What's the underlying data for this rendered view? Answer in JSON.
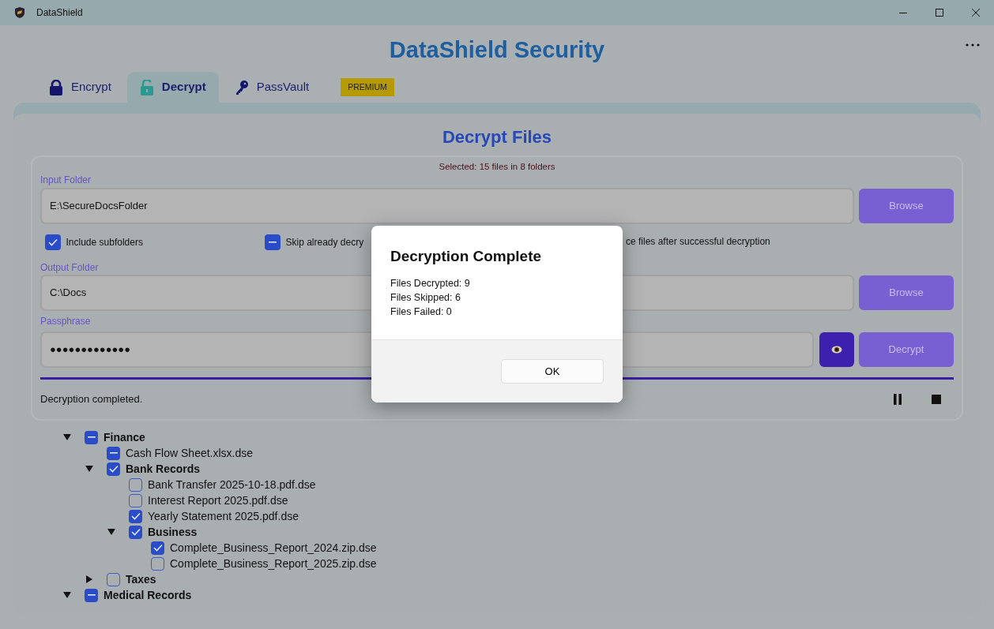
{
  "window": {
    "title": "DataShield"
  },
  "app_title": "DataShield Security",
  "tabs": [
    {
      "label": "Encrypt",
      "selected": false
    },
    {
      "label": "Decrypt",
      "selected": true
    },
    {
      "label": "PassVault",
      "selected": false
    }
  ],
  "premium_badge": "PREMIUM",
  "panel_title": "Decrypt Files",
  "selection_summary": "Selected: 15 files in 8 folders",
  "input_folder": {
    "label": "Input Folder",
    "value": "E:\\SecureDocsFolder",
    "button": "Browse"
  },
  "options": [
    {
      "label": "Include subfolders",
      "checked": true,
      "indeterminate": false
    },
    {
      "label": "Skip already decry",
      "checked": true,
      "indeterminate": true
    },
    {
      "label": "ce files after successful decryption"
    }
  ],
  "output_folder": {
    "label": "Output Folder",
    "value": "C:\\Docs",
    "button": "Browse"
  },
  "passphrase": {
    "label": "Passphrase",
    "value": "●●●●●●●●●●●●●",
    "button": "Decrypt"
  },
  "progress": {
    "level": 1
  },
  "status": "Decryption completed.",
  "tree": [
    {
      "name": "Finance",
      "kind": "folder",
      "expanded": true,
      "checked": true,
      "indeterminate": true,
      "children": [
        {
          "name": "Cash Flow Sheet.xlsx.dse",
          "kind": "file",
          "checked": true,
          "indeterminate": true
        },
        {
          "name": "Bank Records",
          "kind": "folder",
          "expanded": true,
          "checked": true,
          "indeterminate": false,
          "children": [
            {
              "name": "Bank Transfer 2025-10-18.pdf.dse",
              "kind": "file",
              "checked": false
            },
            {
              "name": "Interest Report 2025.pdf.dse",
              "kind": "file",
              "checked": false
            },
            {
              "name": "Yearly Statement 2025.pdf.dse",
              "kind": "file",
              "checked": true,
              "indeterminate": false
            },
            {
              "name": "Business",
              "kind": "folder",
              "expanded": true,
              "checked": true,
              "indeterminate": false,
              "children": [
                {
                  "name": "Complete_Business_Report_2024.zip.dse",
                  "kind": "file",
                  "checked": true,
                  "indeterminate": false
                },
                {
                  "name": "Complete_Business_Report_2025.zip.dse",
                  "kind": "file",
                  "checked": false
                }
              ]
            }
          ]
        },
        {
          "name": "Taxes",
          "kind": "folder",
          "expanded": false,
          "checked": false
        }
      ]
    },
    {
      "name": "Medical Records",
      "kind": "folder",
      "expanded": true,
      "checked": true,
      "indeterminate": true
    }
  ],
  "dialog": {
    "title": "Decryption Complete",
    "lines": [
      "Files Decrypted: 9",
      "Files Skipped: 6",
      "Files Failed: 0"
    ],
    "button": "OK"
  }
}
